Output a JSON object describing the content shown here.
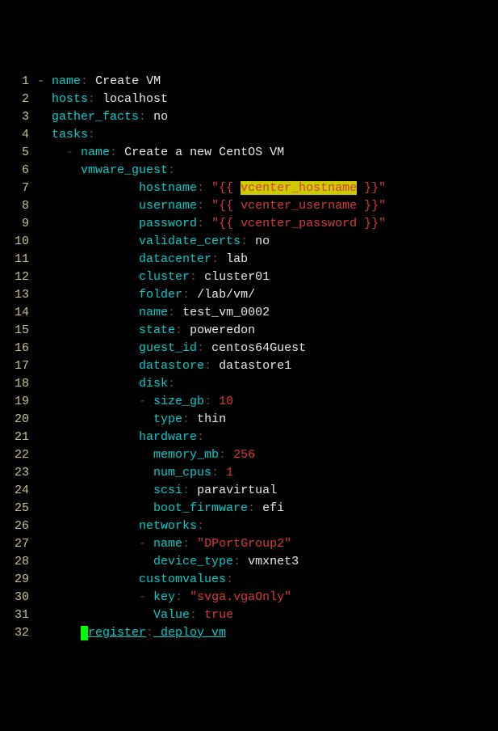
{
  "lines": [
    {
      "num": "1",
      "segments": [
        {
          "t": "fold",
          "v": "-"
        },
        {
          "t": "white",
          "v": " "
        },
        {
          "t": "k-cyan",
          "v": "name"
        },
        {
          "t": "grey",
          "v": ":"
        },
        {
          "t": "white",
          "v": " Create VM"
        }
      ]
    },
    {
      "num": "2",
      "segments": [
        {
          "t": "white",
          "v": "  "
        },
        {
          "t": "k-cyan",
          "v": "hosts"
        },
        {
          "t": "grey",
          "v": ":"
        },
        {
          "t": "white",
          "v": " localhost"
        }
      ]
    },
    {
      "num": "3",
      "segments": [
        {
          "t": "white",
          "v": "  "
        },
        {
          "t": "k-cyan",
          "v": "gather_facts"
        },
        {
          "t": "grey",
          "v": ":"
        },
        {
          "t": "white",
          "v": " no"
        }
      ]
    },
    {
      "num": "4",
      "segments": [
        {
          "t": "white",
          "v": "  "
        },
        {
          "t": "k-cyan",
          "v": "tasks"
        },
        {
          "t": "grey",
          "v": ":"
        }
      ]
    },
    {
      "num": "5",
      "segments": [
        {
          "t": "white",
          "v": "    "
        },
        {
          "t": "grey",
          "v": "- "
        },
        {
          "t": "k-cyan",
          "v": "name"
        },
        {
          "t": "grey",
          "v": ":"
        },
        {
          "t": "white",
          "v": " Create a new CentOS VM"
        }
      ]
    },
    {
      "num": "6",
      "segments": [
        {
          "t": "white",
          "v": "      "
        },
        {
          "t": "k-cyan",
          "v": "vmware_guest"
        },
        {
          "t": "grey",
          "v": ":"
        }
      ]
    },
    {
      "num": "7",
      "segments": [
        {
          "t": "white",
          "v": "              "
        },
        {
          "t": "k-cyan",
          "v": "hostname"
        },
        {
          "t": "grey",
          "v": ":"
        },
        {
          "t": "white",
          "v": " "
        },
        {
          "t": "red",
          "v": "\"{{ "
        },
        {
          "t": "hl",
          "v": "vcenter_hostname"
        },
        {
          "t": "red",
          "v": " }}\""
        }
      ]
    },
    {
      "num": "8",
      "segments": [
        {
          "t": "white",
          "v": "              "
        },
        {
          "t": "k-cyan",
          "v": "username"
        },
        {
          "t": "grey",
          "v": ":"
        },
        {
          "t": "white",
          "v": " "
        },
        {
          "t": "red",
          "v": "\"{{ vcenter_username }}\""
        }
      ]
    },
    {
      "num": "9",
      "segments": [
        {
          "t": "white",
          "v": "              "
        },
        {
          "t": "k-cyan",
          "v": "password"
        },
        {
          "t": "grey",
          "v": ":"
        },
        {
          "t": "white",
          "v": " "
        },
        {
          "t": "red",
          "v": "\"{{ vcenter_password }}\""
        }
      ]
    },
    {
      "num": "10",
      "segments": [
        {
          "t": "white",
          "v": "              "
        },
        {
          "t": "k-cyan",
          "v": "validate_certs"
        },
        {
          "t": "grey",
          "v": ":"
        },
        {
          "t": "white",
          "v": " no"
        }
      ]
    },
    {
      "num": "11",
      "segments": [
        {
          "t": "white",
          "v": "              "
        },
        {
          "t": "k-cyan",
          "v": "datacenter"
        },
        {
          "t": "grey",
          "v": ":"
        },
        {
          "t": "white",
          "v": " lab"
        }
      ]
    },
    {
      "num": "12",
      "segments": [
        {
          "t": "white",
          "v": "              "
        },
        {
          "t": "k-cyan",
          "v": "cluster"
        },
        {
          "t": "grey",
          "v": ":"
        },
        {
          "t": "white",
          "v": " cluster01"
        }
      ]
    },
    {
      "num": "13",
      "segments": [
        {
          "t": "white",
          "v": "              "
        },
        {
          "t": "k-cyan",
          "v": "folder"
        },
        {
          "t": "grey",
          "v": ":"
        },
        {
          "t": "white",
          "v": " /lab/vm/"
        }
      ]
    },
    {
      "num": "14",
      "segments": [
        {
          "t": "white",
          "v": "              "
        },
        {
          "t": "k-cyan",
          "v": "name"
        },
        {
          "t": "grey",
          "v": ":"
        },
        {
          "t": "white",
          "v": " test_vm_0002"
        }
      ]
    },
    {
      "num": "15",
      "segments": [
        {
          "t": "white",
          "v": "              "
        },
        {
          "t": "k-cyan",
          "v": "state"
        },
        {
          "t": "grey",
          "v": ":"
        },
        {
          "t": "white",
          "v": " poweredon"
        }
      ]
    },
    {
      "num": "16",
      "segments": [
        {
          "t": "white",
          "v": "              "
        },
        {
          "t": "k-cyan",
          "v": "guest_id"
        },
        {
          "t": "grey",
          "v": ":"
        },
        {
          "t": "white",
          "v": " centos64Guest"
        }
      ]
    },
    {
      "num": "17",
      "segments": [
        {
          "t": "white",
          "v": "              "
        },
        {
          "t": "k-cyan",
          "v": "datastore"
        },
        {
          "t": "grey",
          "v": ":"
        },
        {
          "t": "white",
          "v": " datastore1"
        }
      ]
    },
    {
      "num": "18",
      "segments": [
        {
          "t": "white",
          "v": "              "
        },
        {
          "t": "k-cyan",
          "v": "disk"
        },
        {
          "t": "grey",
          "v": ":"
        }
      ]
    },
    {
      "num": "19",
      "segments": [
        {
          "t": "white",
          "v": "              "
        },
        {
          "t": "grey",
          "v": "- "
        },
        {
          "t": "k-cyan",
          "v": "size_gb"
        },
        {
          "t": "grey",
          "v": ":"
        },
        {
          "t": "white",
          "v": " "
        },
        {
          "t": "red",
          "v": "10"
        }
      ]
    },
    {
      "num": "20",
      "segments": [
        {
          "t": "white",
          "v": "                "
        },
        {
          "t": "k-cyan",
          "v": "type"
        },
        {
          "t": "grey",
          "v": ":"
        },
        {
          "t": "white",
          "v": " thin"
        }
      ]
    },
    {
      "num": "21",
      "segments": [
        {
          "t": "white",
          "v": "              "
        },
        {
          "t": "k-cyan",
          "v": "hardware"
        },
        {
          "t": "grey",
          "v": ":"
        }
      ]
    },
    {
      "num": "22",
      "segments": [
        {
          "t": "white",
          "v": "                "
        },
        {
          "t": "k-cyan",
          "v": "memory_mb"
        },
        {
          "t": "grey",
          "v": ":"
        },
        {
          "t": "white",
          "v": " "
        },
        {
          "t": "red",
          "v": "256"
        }
      ]
    },
    {
      "num": "23",
      "segments": [
        {
          "t": "white",
          "v": "                "
        },
        {
          "t": "k-cyan",
          "v": "num_cpus"
        },
        {
          "t": "grey",
          "v": ":"
        },
        {
          "t": "white",
          "v": " "
        },
        {
          "t": "red",
          "v": "1"
        }
      ]
    },
    {
      "num": "24",
      "segments": [
        {
          "t": "white",
          "v": "                "
        },
        {
          "t": "k-cyan",
          "v": "scsi"
        },
        {
          "t": "grey",
          "v": ":"
        },
        {
          "t": "white",
          "v": " paravirtual"
        }
      ]
    },
    {
      "num": "25",
      "segments": [
        {
          "t": "white",
          "v": "                "
        },
        {
          "t": "k-cyan",
          "v": "boot_firmware"
        },
        {
          "t": "grey",
          "v": ":"
        },
        {
          "t": "white",
          "v": " efi"
        }
      ]
    },
    {
      "num": "26",
      "segments": [
        {
          "t": "white",
          "v": "              "
        },
        {
          "t": "k-cyan",
          "v": "networks"
        },
        {
          "t": "grey",
          "v": ":"
        }
      ]
    },
    {
      "num": "27",
      "segments": [
        {
          "t": "white",
          "v": "              "
        },
        {
          "t": "grey",
          "v": "- "
        },
        {
          "t": "k-cyan",
          "v": "name"
        },
        {
          "t": "grey",
          "v": ":"
        },
        {
          "t": "white",
          "v": " "
        },
        {
          "t": "red",
          "v": "\"DPortGroup2\""
        }
      ]
    },
    {
      "num": "28",
      "segments": [
        {
          "t": "white",
          "v": "                "
        },
        {
          "t": "k-cyan",
          "v": "device_type"
        },
        {
          "t": "grey",
          "v": ":"
        },
        {
          "t": "white",
          "v": " vmxnet3"
        }
      ]
    },
    {
      "num": "29",
      "segments": [
        {
          "t": "white",
          "v": "              "
        },
        {
          "t": "k-cyan",
          "v": "customvalues"
        },
        {
          "t": "grey",
          "v": ":"
        }
      ]
    },
    {
      "num": "30",
      "segments": [
        {
          "t": "white",
          "v": "              "
        },
        {
          "t": "grey",
          "v": "- "
        },
        {
          "t": "k-cyan",
          "v": "key"
        },
        {
          "t": "grey",
          "v": ":"
        },
        {
          "t": "white",
          "v": " "
        },
        {
          "t": "red",
          "v": "\"svga.vgaOnly\""
        }
      ]
    },
    {
      "num": "31",
      "segments": [
        {
          "t": "white",
          "v": "                "
        },
        {
          "t": "k-cyan",
          "v": "Value"
        },
        {
          "t": "grey",
          "v": ":"
        },
        {
          "t": "white",
          "v": " "
        },
        {
          "t": "red",
          "v": "true"
        }
      ]
    },
    {
      "num": "32",
      "segments": [
        {
          "t": "white",
          "v": "      "
        },
        {
          "t": "cursor",
          "v": " "
        },
        {
          "t": "k-cyan-u",
          "v": "register"
        },
        {
          "t": "grey",
          "v": ":"
        },
        {
          "t": "k-cyan-u",
          "v": " deploy_vm"
        }
      ]
    }
  ]
}
